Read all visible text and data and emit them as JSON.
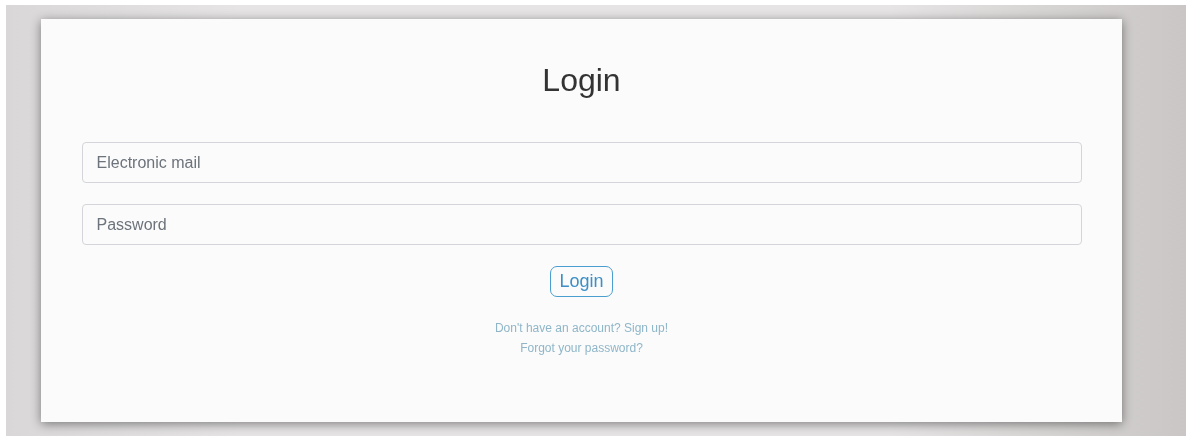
{
  "title": "Login",
  "fields": [
    {
      "placeholder": "Electronic mail"
    },
    {
      "placeholder": "Password"
    }
  ],
  "submit": "Login",
  "links": [
    "Don't have an account? Sign up!",
    "Forgot your password?"
  ]
}
